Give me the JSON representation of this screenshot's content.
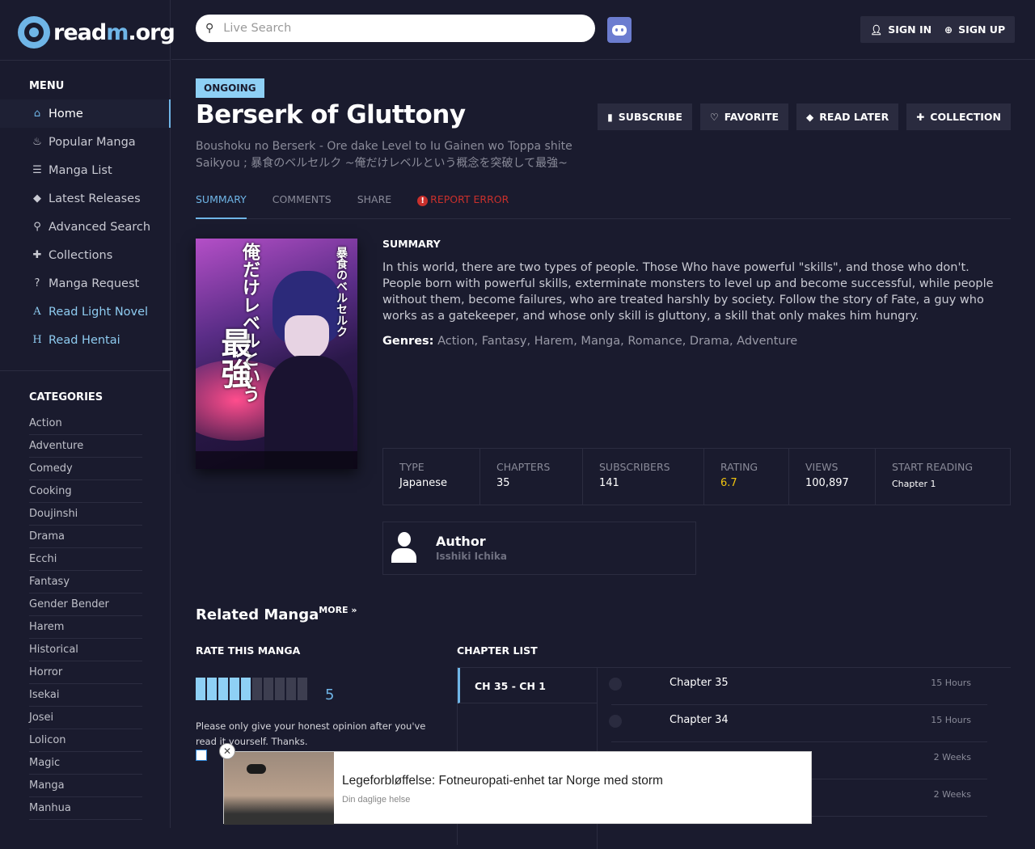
{
  "site": {
    "logo_part1": "read",
    "logo_part2": "m",
    "logo_part3": ".org"
  },
  "menu": {
    "heading": "MENU",
    "items": [
      {
        "label": "Home",
        "icon": "home-icon"
      },
      {
        "label": "Popular Manga",
        "icon": "fire-icon"
      },
      {
        "label": "Manga List",
        "icon": "list-icon"
      },
      {
        "label": "Latest Releases",
        "icon": "tag-icon"
      },
      {
        "label": "Advanced Search",
        "icon": "search-icon"
      },
      {
        "label": "Collections",
        "icon": "plus-icon"
      },
      {
        "label": "Manga Request",
        "icon": "question-icon"
      },
      {
        "label": "Read Light Novel",
        "icon": "letter-a-icon"
      },
      {
        "label": "Read Hentai",
        "icon": "letter-h-icon"
      }
    ]
  },
  "categories": {
    "heading": "CATEGORIES",
    "items": [
      "Action",
      "Adventure",
      "Comedy",
      "Cooking",
      "Doujinshi",
      "Drama",
      "Ecchi",
      "Fantasy",
      "Gender Bender",
      "Harem",
      "Historical",
      "Horror",
      "Isekai",
      "Josei",
      "Lolicon",
      "Magic",
      "Manga",
      "Manhua"
    ]
  },
  "header": {
    "search_placeholder": "Live Search",
    "sign_in": "SIGN IN",
    "sign_up": "SIGN UP"
  },
  "manga": {
    "status": "ONGOING",
    "title": "Berserk of Gluttony",
    "alt_titles": "Boushoku no Berserk - Ore dake Level to Iu Gainen wo Toppa shite Saikyou ; 暴食のベルセルク ~俺だけレベルという概念を突破して最強~",
    "actions": {
      "subscribe": "SUBSCRIBE",
      "favorite": "FAVORITE",
      "read_later": "READ LATER",
      "collection": "COLLECTION"
    },
    "tabs": {
      "summary": "SUMMARY",
      "comments": "COMMENTS",
      "share": "SHARE",
      "report": "REPORT ERROR"
    },
    "cover_text": {
      "line1": "暴食のベルセルク",
      "line2": "俺だけレベルという",
      "line3": "最強"
    },
    "summary_heading": "SUMMARY",
    "summary": "In this world, there are two types of people. Those Who have powerful \"skills\", and those who don't. People born with powerful skills, exterminate monsters to level up and become successful, while people without them, become failures, who are treated harshly by society. Follow the story of Fate, a guy who works as a gatekeeper, and whose only skill is gluttony, a skill that only makes him hungry.",
    "genres_label": "Genres:",
    "genres": "Action, Fantasy, Harem, Manga, Romance, Drama, Adventure",
    "stats": [
      {
        "key": "TYPE",
        "value": "Japanese"
      },
      {
        "key": "CHAPTERS",
        "value": "35"
      },
      {
        "key": "SUBSCRIBERS",
        "value": "141"
      },
      {
        "key": "RATING",
        "value": "6.7"
      },
      {
        "key": "VIEWS",
        "value": "100,897"
      },
      {
        "key": "START READING",
        "value": "Chapter 1"
      }
    ],
    "author_label": "Author",
    "author_name": "Isshiki Ichika"
  },
  "related": {
    "heading": "Related Manga",
    "more": "MORE »"
  },
  "rating": {
    "heading": "RATE THIS MANGA",
    "value": "5",
    "filled": 5,
    "total": 10,
    "note": "Please only give your honest opinion after you've read it yourself. Thanks."
  },
  "chapters": {
    "heading": "CHAPTER LIST",
    "range": "CH 35 - CH 1",
    "rows": [
      {
        "title": "Chapter 35",
        "date": "15 Hours"
      },
      {
        "title": "Chapter 34",
        "date": "15 Hours"
      },
      {
        "title": "",
        "date": "2 Weeks"
      },
      {
        "title": "",
        "date": "2 Weeks"
      }
    ]
  },
  "ad": {
    "headline": "Legeforbløffelse: Fotneuropati-enhet tar Norge med storm",
    "source": "Din daglige helse",
    "close": "✕"
  }
}
